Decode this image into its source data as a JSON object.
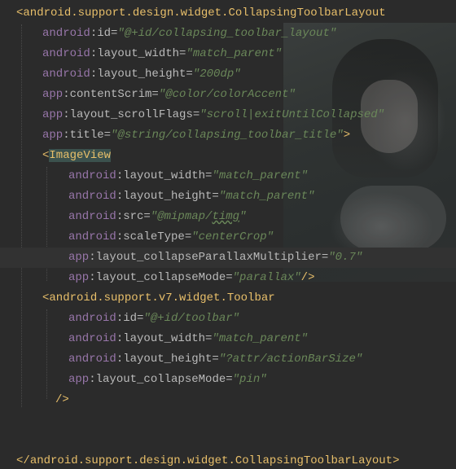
{
  "editor": {
    "lines": [
      {
        "indent": 1,
        "tokens": [
          {
            "t": "bracket",
            "v": "<"
          },
          {
            "t": "tag",
            "v": "android.support.design.widget.CollapsingToolbarLayout"
          }
        ]
      },
      {
        "indent": 2,
        "tokens": [
          {
            "t": "ns",
            "v": "android"
          },
          {
            "t": "attr",
            "v": ":id="
          },
          {
            "t": "val",
            "v": "\"@+id/collapsing_toolbar_layout\""
          }
        ]
      },
      {
        "indent": 2,
        "tokens": [
          {
            "t": "ns",
            "v": "android"
          },
          {
            "t": "attr",
            "v": ":layout_width="
          },
          {
            "t": "val",
            "v": "\"match_parent\""
          }
        ]
      },
      {
        "indent": 2,
        "tokens": [
          {
            "t": "ns",
            "v": "android"
          },
          {
            "t": "attr",
            "v": ":layout_height="
          },
          {
            "t": "val",
            "v": "\"200dp\""
          }
        ]
      },
      {
        "indent": 2,
        "tokens": [
          {
            "t": "ns",
            "v": "app"
          },
          {
            "t": "attr",
            "v": ":contentScrim="
          },
          {
            "t": "val",
            "v": "\"@color/colorAccent\""
          }
        ]
      },
      {
        "indent": 2,
        "tokens": [
          {
            "t": "ns",
            "v": "app"
          },
          {
            "t": "attr",
            "v": ":layout_scrollFlags="
          },
          {
            "t": "val",
            "v": "\"scroll|exitUntilCollapsed\""
          }
        ]
      },
      {
        "indent": 2,
        "tokens": [
          {
            "t": "ns",
            "v": "app"
          },
          {
            "t": "attr",
            "v": ":title="
          },
          {
            "t": "val",
            "v": "\"@string/collapsing_toolbar_title\""
          },
          {
            "t": "bracket",
            "v": ">"
          }
        ]
      },
      {
        "indent": 2,
        "tokens": [
          {
            "t": "bracket",
            "v": "<"
          },
          {
            "t": "tag-hl",
            "v": "ImageView"
          }
        ]
      },
      {
        "indent": 3,
        "tokens": [
          {
            "t": "ns",
            "v": "android"
          },
          {
            "t": "attr",
            "v": ":layout_width="
          },
          {
            "t": "val",
            "v": "\"match_parent\""
          }
        ]
      },
      {
        "indent": 3,
        "tokens": [
          {
            "t": "ns",
            "v": "android"
          },
          {
            "t": "attr",
            "v": ":layout_height="
          },
          {
            "t": "val",
            "v": "\"match_parent\""
          }
        ]
      },
      {
        "indent": 3,
        "tokens": [
          {
            "t": "ns",
            "v": "android"
          },
          {
            "t": "attr",
            "v": ":src="
          },
          {
            "t": "val",
            "v": "\"@mipmap/"
          },
          {
            "t": "val-sq",
            "v": "timg"
          },
          {
            "t": "val",
            "v": "\""
          }
        ]
      },
      {
        "indent": 3,
        "tokens": [
          {
            "t": "ns",
            "v": "android"
          },
          {
            "t": "attr",
            "v": ":scaleType="
          },
          {
            "t": "val",
            "v": "\"centerCrop\""
          }
        ]
      },
      {
        "indent": 3,
        "current": true,
        "tokens": [
          {
            "t": "ns",
            "v": "app"
          },
          {
            "t": "attr",
            "v": ":layout_collapseParallaxMultiplier="
          },
          {
            "t": "val",
            "v": "\"0.7\""
          }
        ]
      },
      {
        "indent": 3,
        "tokens": [
          {
            "t": "ns",
            "v": "app"
          },
          {
            "t": "attr",
            "v": ":layout_collapseMode="
          },
          {
            "t": "val",
            "v": "\"parallax\""
          },
          {
            "t": "bracket",
            "v": "/>"
          }
        ]
      },
      {
        "indent": 2,
        "tokens": [
          {
            "t": "bracket",
            "v": "<"
          },
          {
            "t": "tag",
            "v": "android.support.v7.widget.Toolbar"
          }
        ]
      },
      {
        "indent": 3,
        "tokens": [
          {
            "t": "ns",
            "v": "android"
          },
          {
            "t": "attr",
            "v": ":id="
          },
          {
            "t": "val",
            "v": "\"@+id/toolbar\""
          }
        ]
      },
      {
        "indent": 3,
        "tokens": [
          {
            "t": "ns",
            "v": "android"
          },
          {
            "t": "attr",
            "v": ":layout_width="
          },
          {
            "t": "val",
            "v": "\"match_parent\""
          }
        ]
      },
      {
        "indent": 3,
        "tokens": [
          {
            "t": "ns",
            "v": "android"
          },
          {
            "t": "attr",
            "v": ":layout_height="
          },
          {
            "t": "val",
            "v": "\"?attr/actionBarSize\""
          }
        ]
      },
      {
        "indent": 3,
        "tokens": [
          {
            "t": "ns",
            "v": "app"
          },
          {
            "t": "attr",
            "v": ":layout_collapseMode="
          },
          {
            "t": "val",
            "v": "\"pin\""
          }
        ]
      },
      {
        "indent": 2.5,
        "tokens": [
          {
            "t": "bracket",
            "v": "/>"
          }
        ]
      },
      {
        "indent": 0,
        "tokens": []
      },
      {
        "indent": 0,
        "tokens": []
      },
      {
        "indent": 1,
        "tokens": [
          {
            "t": "bracket",
            "v": "</"
          },
          {
            "t": "tag",
            "v": "android.support.design.widget.CollapsingToolbarLayout"
          },
          {
            "t": "bracket",
            "v": ">"
          }
        ]
      }
    ],
    "colors": {
      "background": "#2b2b2b",
      "tag": "#e8bf6a",
      "namespace": "#9876aa",
      "attribute": "#bababa",
      "value": "#6a8759"
    }
  }
}
